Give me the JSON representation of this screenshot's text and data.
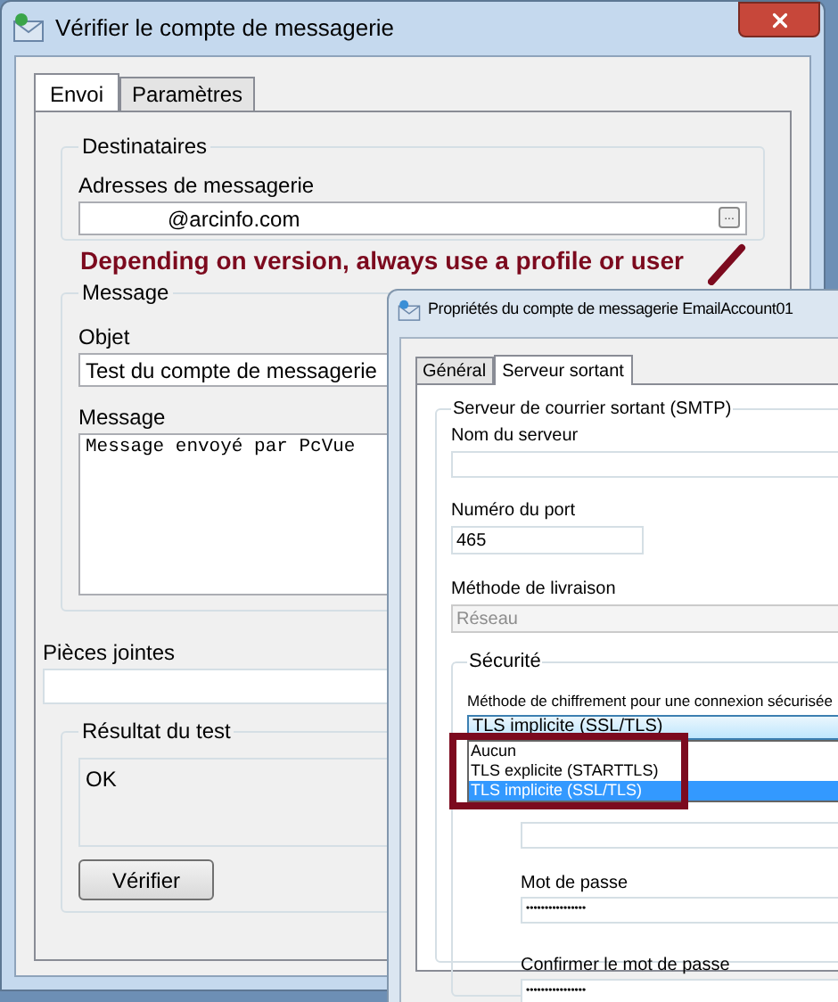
{
  "main_window": {
    "title": "Vérifier le compte de messagerie",
    "tabs": [
      {
        "label": "Envoi",
        "selected": true
      },
      {
        "label": "Paramètres",
        "selected": false
      }
    ],
    "recipients": {
      "title": "Destinataires",
      "label": "Adresses de messagerie",
      "value": "@arcinfo.com",
      "browse": "..."
    },
    "annotation": "Depending on version, always use a profile  or user",
    "message": {
      "title": "Message",
      "subject_label": "Objet",
      "subject": "Test du compte de messagerie",
      "body_label": "Message",
      "body": "Message envoyé par PcVue"
    },
    "attachments": {
      "label": "Pièces jointes"
    },
    "test_result": {
      "title": "Résultat du test",
      "output": "OK",
      "button": "Vérifier"
    }
  },
  "properties_window": {
    "title": "Propriétés du compte de messagerie EmailAccount01",
    "tabs": [
      {
        "label": "Général",
        "selected": false
      },
      {
        "label": "Serveur sortant",
        "selected": true
      }
    ],
    "smtp": {
      "title": "Serveur de courrier sortant (SMTP)",
      "server_label": "Nom du serveur",
      "port_label": "Numéro du port",
      "port": "465",
      "delivery_label": "Méthode de livraison",
      "delivery": "Réseau",
      "delivery_disabled": true
    },
    "security": {
      "title": "Sécurité",
      "encryption_label": "Méthode de chiffrement pour une connexion sécurisée",
      "encryption": "TLS implicite (SSL/TLS)",
      "options": [
        {
          "label": "Aucun",
          "selected": false
        },
        {
          "label": "TLS explicite (STARTTLS)",
          "selected": false
        },
        {
          "label": "TLS implicite (SSL/TLS)",
          "selected": true
        }
      ],
      "password_label": "Mot de passe",
      "password": "••••••••••••••••",
      "confirm_label": "Confirmer le mot de passe",
      "confirm": "••••••••••••••••"
    }
  }
}
